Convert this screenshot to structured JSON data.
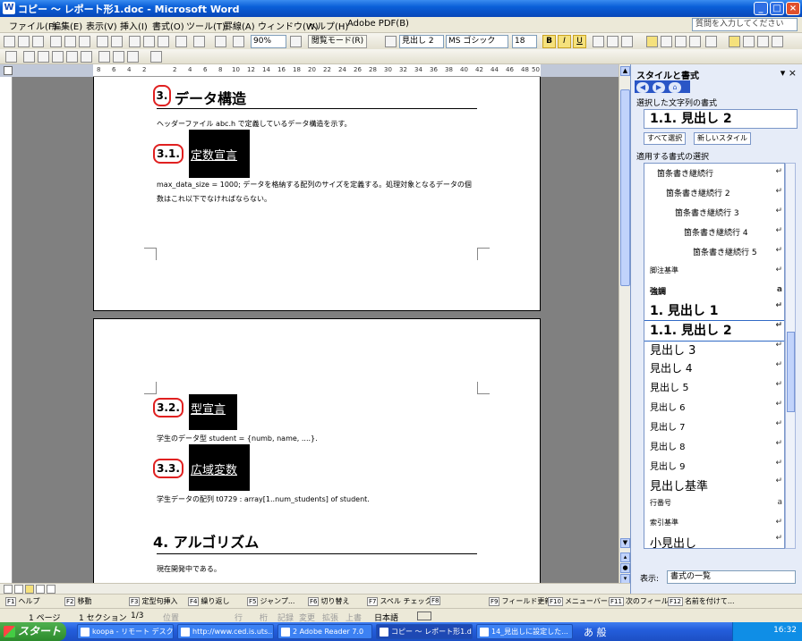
{
  "window": {
    "title": "コピー ～ レポート形1.doc - Microsoft Word",
    "app_icon": "W"
  },
  "menu": [
    "ファイル(F)",
    "編集(E)",
    "表示(V)",
    "挿入(I)",
    "書式(O)",
    "ツール(T)",
    "罫線(A)",
    "ウィンドウ(W)",
    "ヘルプ(H)",
    "Adobe PDF(B)"
  ],
  "help_placeholder": "質問を入力してください",
  "toolbar": {
    "zoom": "90%",
    "reading_mode": "閲覧モード(R)",
    "style": "見出し 2",
    "font": "MS ゴシック",
    "size": "18",
    "bold": "B",
    "italic": "I",
    "underline": "U"
  },
  "ruler_ticks": [
    "8",
    "6",
    "4",
    "2",
    "2",
    "4",
    "6",
    "8",
    "10",
    "12",
    "14",
    "16",
    "18",
    "20",
    "22",
    "24",
    "26",
    "28",
    "30",
    "32",
    "34",
    "36",
    "38",
    "40",
    "42",
    "44",
    "46",
    "48",
    "50"
  ],
  "doc": {
    "h3": "データ構造",
    "h3_num": "3.",
    "intro": "ヘッダーファイル abc.h で定義しているデータ構造を示す。",
    "s31_num": "3.1.",
    "s31": "定数宣言",
    "p31_line1": "max_data_size = 1000; データを格納する配列のサイズを定義する。処理対象となるデータの個",
    "p31_line2": "数はこれ以下でなければならない。",
    "s32_num": "3.2.",
    "s32": "型宣言",
    "p32": "学生のデータ型  student = {numb, name, ....}.",
    "s33_num": "3.3.",
    "s33": "広域変数",
    "p33": "学生データの配列  t0729 : array[1..num_students] of student.",
    "h4": "4. アルゴリズム",
    "p4": "現在開発中である。"
  },
  "pane": {
    "title": "スタイルと書式",
    "selected_label": "選択した文字列の書式",
    "current_style": "1.1.  見出し 2",
    "select_all": "すべて選択",
    "new_style": "新しいスタイル",
    "apply_label": "適用する書式の選択",
    "styles": [
      {
        "name": "箇条書き継続行",
        "mark": "↵"
      },
      {
        "name": "箇条書き継続行 2",
        "mark": "↵"
      },
      {
        "name": "箇条書き継続行 3",
        "mark": "↵"
      },
      {
        "name": "箇条書き継続行 4",
        "mark": "↵"
      },
      {
        "name": "箇条書き継続行 5",
        "mark": "↵"
      },
      {
        "name": "脚注基準",
        "mark": "↵"
      },
      {
        "name": "強調",
        "mark": "a"
      },
      {
        "name": "1.  見出し 1",
        "mark": "↵"
      },
      {
        "name": "1.1.  見出し 2",
        "mark": "↵"
      },
      {
        "name": "見出し 3",
        "mark": "↵"
      },
      {
        "name": "見出し 4",
        "mark": "↵"
      },
      {
        "name": "見出し 5",
        "mark": "↵"
      },
      {
        "name": "見出し 6",
        "mark": "↵"
      },
      {
        "name": "見出し 7",
        "mark": "↵"
      },
      {
        "name": "見出し 8",
        "mark": "↵"
      },
      {
        "name": "見出し 9",
        "mark": "↵"
      },
      {
        "name": "見出し基準",
        "mark": "↵"
      },
      {
        "name": "行番号",
        "mark": "a"
      },
      {
        "name": "索引基準",
        "mark": "↵"
      },
      {
        "name": "小見出し",
        "mark": "↵"
      }
    ],
    "show_label": "表示:",
    "show_value": "書式の一覧"
  },
  "fkeys": [
    {
      "key": "F1",
      "label": "ヘルプ"
    },
    {
      "key": "F2",
      "label": "移動"
    },
    {
      "key": "F3",
      "label": "定型句挿入"
    },
    {
      "key": "F4",
      "label": "繰り返し"
    },
    {
      "key": "F5",
      "label": "ジャンプ..."
    },
    {
      "key": "F6",
      "label": "切り替え"
    },
    {
      "key": "F7",
      "label": "スペル チェック..."
    },
    {
      "key": "F8",
      "label": ""
    },
    {
      "key": "F9",
      "label": "フィールド更新"
    },
    {
      "key": "F10",
      "label": "メニューバーに"
    },
    {
      "key": "F11",
      "label": "次のフィールド"
    },
    {
      "key": "F12",
      "label": "名前を付けて..."
    }
  ],
  "status": {
    "page": "1 ページ",
    "section": "1 セクション",
    "pos": "1/3",
    "loc": "位置",
    "line": "行",
    "col": "桁",
    "rec": "記録",
    "trk": "変更",
    "ext": "拡張",
    "ovr": "上書",
    "lang": "日本語"
  },
  "taskbar": {
    "start": "スタート",
    "tasks": [
      "koopa - リモート デスク...",
      "http://www.ced.is.uts...",
      "2 Adobe Reader 7.0",
      "コピー ～ レポート形1.d...",
      "14_見出しに設定した..."
    ],
    "ime": "あ 般",
    "clock": "16:32"
  }
}
